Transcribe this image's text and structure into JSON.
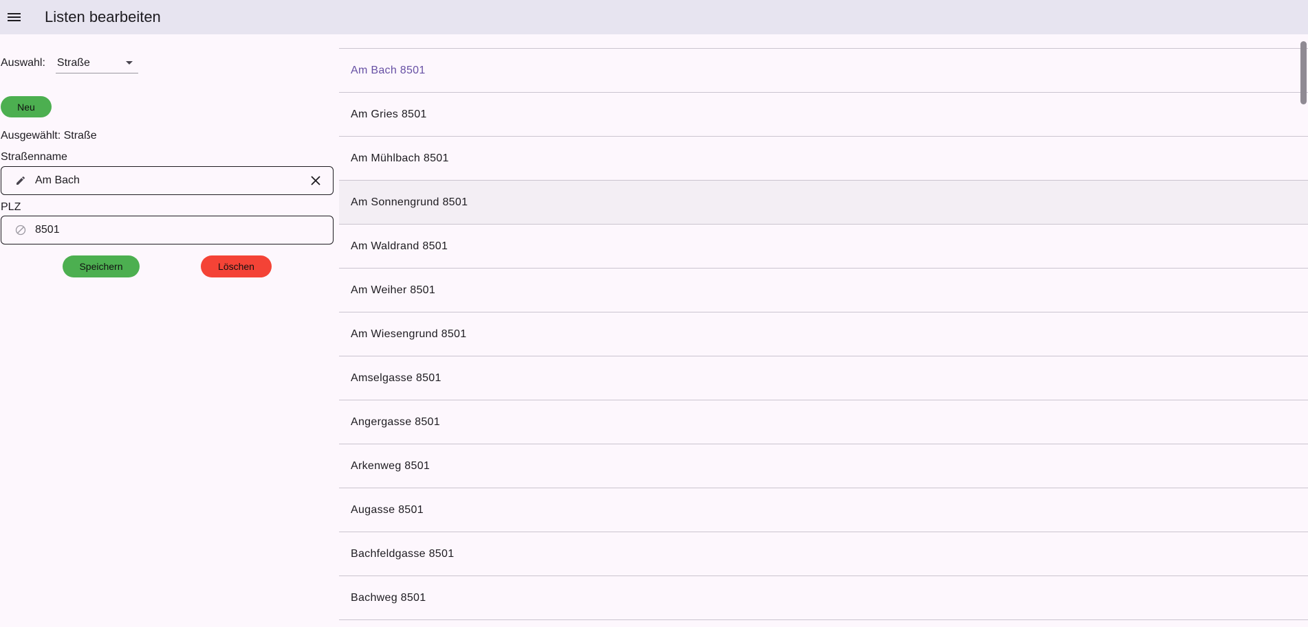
{
  "appbar": {
    "menu_icon": "menu-icon",
    "title": "Listen bearbeiten"
  },
  "form": {
    "auswahl_label": "Auswahl:",
    "auswahl_value": "Straße",
    "new_label": "Neu",
    "selected_text": "Ausgewählt: Straße",
    "street_label": "Straßenname",
    "street_value": "Am Bach",
    "plz_label": "PLZ",
    "plz_value": "8501",
    "save_label": "Speichern",
    "delete_label": "Löschen",
    "colors": {
      "save": "#4caf50",
      "delete": "#f44336",
      "new": "#4caf50"
    }
  },
  "list": {
    "active_color": "#6750a4",
    "items": [
      {
        "text": "Am Bach  8501"
      },
      {
        "text": "Am Gries  8501"
      },
      {
        "text": "Am Mühlbach  8501"
      },
      {
        "text": "Am Sonnengrund  8501"
      },
      {
        "text": "Am Waldrand  8501"
      },
      {
        "text": "Am Weiher  8501"
      },
      {
        "text": "Am Wiesengrund  8501"
      },
      {
        "text": "Amselgasse  8501"
      },
      {
        "text": "Angergasse  8501"
      },
      {
        "text": "Arkenweg  8501"
      },
      {
        "text": "Augasse  8501"
      },
      {
        "text": "Bachfeldgasse  8501"
      },
      {
        "text": "Bachweg  8501"
      }
    ]
  }
}
